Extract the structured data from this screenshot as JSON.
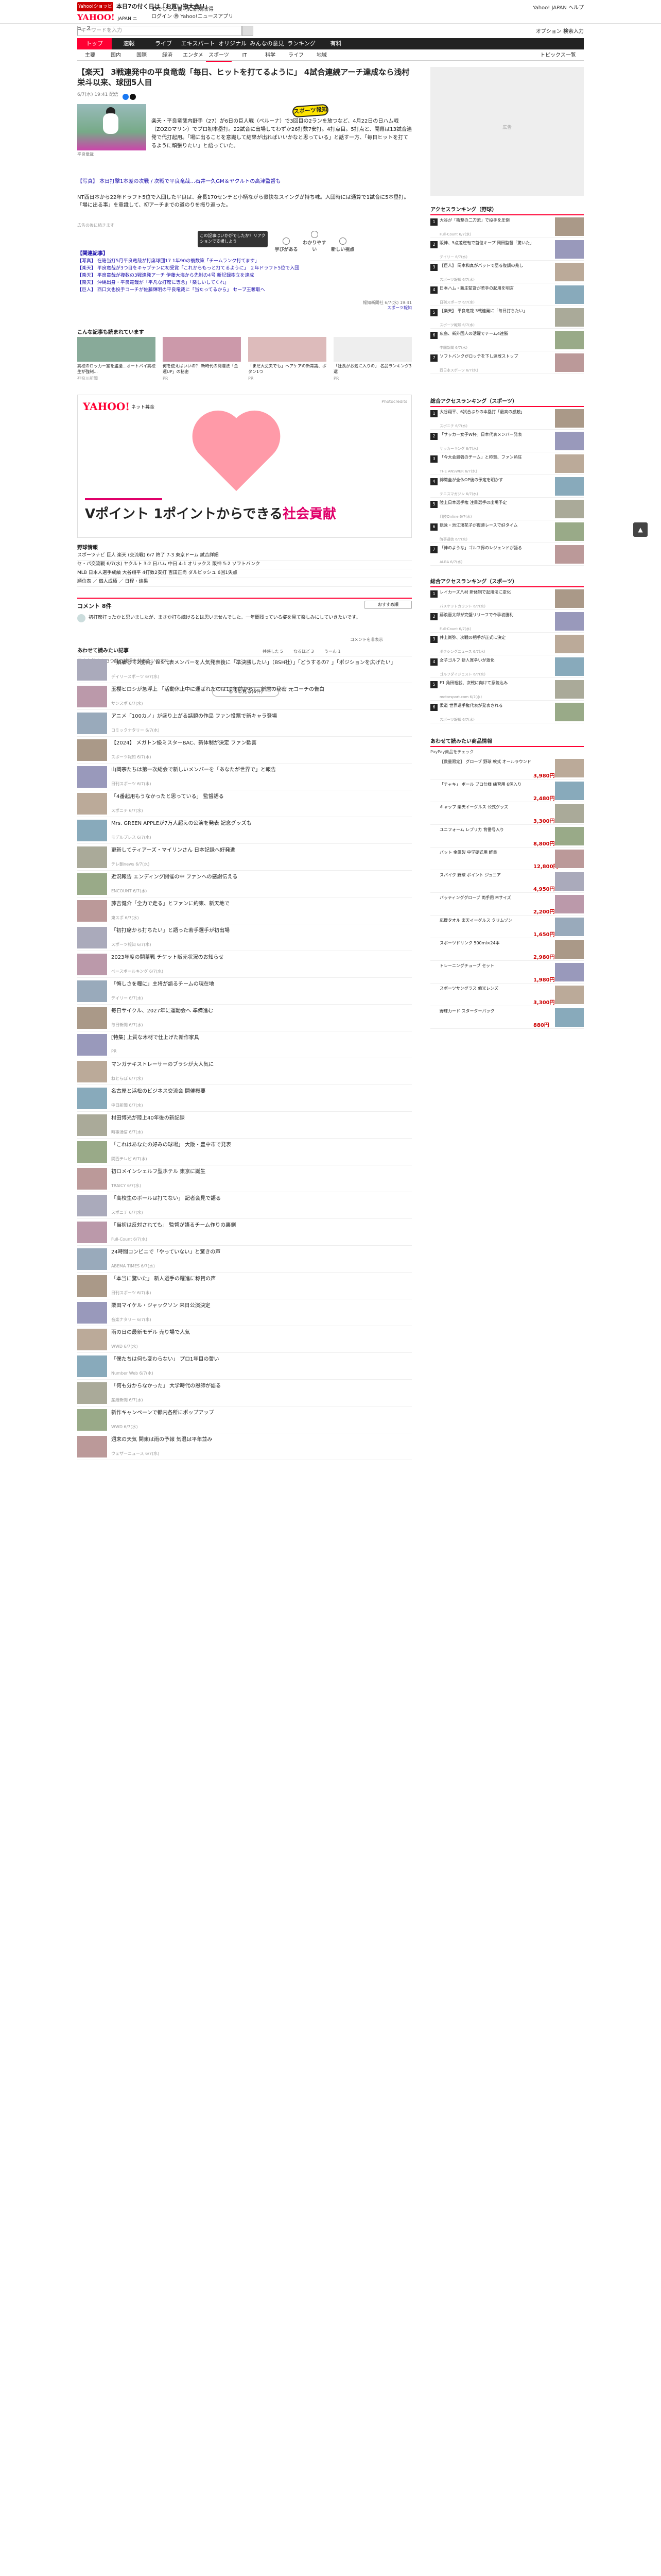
{
  "masthead": {
    "promo_badge": "Yahoo!ショッピング",
    "promo_text": "本日7の付く日は「お買い物大会!!」",
    "logo": "YAHOO!",
    "logo_sub": "JAPAN ニュース",
    "toplinks": "IDでもっと便利に新規取得\nログイン ㊚ Yahoo!ニュースアプリ",
    "topright": "Yahoo! JAPAN  ヘルプ",
    "search_placeholder": "キーワードを入力",
    "search_options": "オプション  検索入力"
  },
  "nav": {
    "items": [
      "トップ",
      "速報",
      "ライブ",
      "エキスパート",
      "オリジナル",
      "みんなの意見",
      "ランキング",
      "有料"
    ],
    "active": 0
  },
  "subnav": {
    "items": [
      "主要",
      "国内",
      "国際",
      "経済",
      "エンタメ",
      "スポーツ",
      "IT",
      "科学",
      "ライフ",
      "地域"
    ],
    "more": "トピックス一覧"
  },
  "article": {
    "title": "【楽天】 3戦連発中の平良竜哉「毎日、ヒットを打てるように」 4試合連続アーチ達成なら浅村栄斗以来、球団5人目",
    "meta": "6/7(水) 19:41 配信",
    "badge": "スポーツ報知",
    "photo_caption": "平良竜哉",
    "lead": "楽天・平良竜哉内野手（27）が6日の巨人戦（ペルーナ）で3回目の2ランを放つなど、4月22日の日ハム戦（ZOZOマリン）でプロ初本塁打。22試合に出場してわずか26打数7安打。4打点目。5打点と、開幕は13試合連発で代打起用。「場に出ることを意識して結果が出ればいいかなと思っている」と話す一方、「毎日ヒットを打てるように頑張りたい」と語っていた。",
    "related": "【写真】 本日打撃1本差の次戦 / 次戦で平良竜哉…石井一久GM＆ヤクルトの高津監督も",
    "body": "NT西日本から22年ドラフト5位で入団した平良は、身長170センチと小柄ながら豪快なスイングが持ち味。入団時には通算で1試合に5本塁打。「場に出る事」を意識して、初アーチまでの道のりを振り返った。",
    "ad_label": "広告の後に続きます",
    "tip": "この記事はいかがでしたか？リアクションで支援しよう",
    "reactions": [
      "学びがある",
      "わかりやすい",
      "新しい視点"
    ],
    "related_heading": "【関連記事】",
    "related_list": [
      "【写真】 在籍当打5月平良竜哉が打席球団17 1年90の複数策「チームランク打てます」",
      "【楽天】 平良竜哉が3つ目をキャプテンに初受賞「これからもっと打てるように」 ２年ドラフト5位で入団",
      "【楽天】 平良竜哉が複数の3戦連発アーチ 伊藤大海から先制の4号 新記録樹立を達成",
      "【楽天】 沖縄出身・平良竜哉が「平凡な打席に専念」「楽しいしてくれ」",
      "【巨人】 西口文也投手コーチが佐藤輝明の平良竜哉に「当たってるから」 セーブ王奪取へ"
    ],
    "credit": "報知新聞社 6/7(水) 19:41",
    "credit_link": "スポーツ報知"
  },
  "recommend": {
    "heading": "こんな記事も読まれています",
    "cards": [
      {
        "text": "高校のロッカー室を盗撮…オートバイ高校生が強制…",
        "src": "神奈川新聞"
      },
      {
        "text": "何を使えばいいの？ 新時代の開運法「金運UP」の秘密",
        "src": "PR"
      },
      {
        "text": "「まだ大丈夫でも」ヘアケアの新常識、ボタン1つ",
        "src": "PR"
      },
      {
        "text": "「社長がお気に入りの」 名品ランキング3選",
        "src": "PR"
      }
    ]
  },
  "bigad": {
    "logo": "YAHOO!",
    "logo_sub": "ネット募金",
    "credit": "Photocredits",
    "headline_1": "Vポイント",
    "headline_2": "1ポイントからできる",
    "headline_3": "社会貢献"
  },
  "scores": {
    "heading": "野球情報",
    "rows": [
      "スポーツナビ  巨人 楽天 (交流戦) 6/7 終了  7-3  東京ドーム  試合詳細",
      "セ・パ交流戦 6/7(水)  ヤクルト 3-2 日ハム  中日 4-1 オリックス  阪神 5-2 ソフトバンク",
      "MLB 日本人選手成績  大谷翔平 4打数2安打  吉田正尚  ダルビッシュ 6回1失点",
      "順位表 ／ 個人成績 ／ 日程・結果"
    ]
  },
  "comments": {
    "heading": "コメント 8件",
    "sort": "おすすめ順",
    "first_text": "初打席打ったかと思いましたが、まさか打ち続けるとは思いませんでした。一年間残っている姿を見て楽しみにしていきたいです。",
    "actions": [
      "共感した 5",
      "なるほど 3",
      "うーん 1"
    ],
    "second_text": "平良竜哉さん 3つ目の球場を持ちたいです",
    "more": "もっと見る(6件)",
    "hide_label": "コメントを非表示"
  },
  "list": {
    "heading": "あわせて読みたい記事",
    "items": [
      {
        "t": "「解雇して2度目」BIS代表メンバーを人気発表後に「準決勝したい」（BSH社）」「どうするの？」「ポジションを広げたい」",
        "s": "デイリースポーツ 6/7(水)"
      },
      {
        "t": "玉櫻ヒロシが急浮上 「活動休止中に運ばれたのは10年前から」、新居の秘密 元コーチの告白",
        "s": "サンスポ 6/7(水)"
      },
      {
        "t": "アニメ「100カノ」が盛り上がる話題の作品 ファン投票で新キャラ登場",
        "s": "コミックナタリー 6/7(水)"
      },
      {
        "t": "【2024】 メガトン級ミスターBAC、新体制が決定 ファン歓喜",
        "s": "スポーツ報知 6/7(水)"
      },
      {
        "t": "山岡宗たちは第一次総会で新しいメンバーを「あなたが世界で」と報告",
        "s": "日刊スポーツ 6/7(水)"
      },
      {
        "t": "「4番起用もうなかったと思っている」 監督語る",
        "s": "スポニチ 6/7(水)"
      },
      {
        "t": "Mrs. GREEN APPLEが7万人超えの公演を発表 記念グッズも",
        "s": "モデルプレス 6/7(水)"
      },
      {
        "t": "更新してティアーズ・マイリンさん 日本記録へ好発進",
        "s": "テレ朝news 6/7(水)"
      },
      {
        "t": "近況報告 エンディング開催の中 ファンへの感謝伝える",
        "s": "ENCOUNT 6/7(水)"
      },
      {
        "t": "藤吉健介「全力で走る」とファンに約束、新天地で",
        "s": "東スポ 6/7(水)"
      },
      {
        "t": "「初打席から打ちたい」と語った若手選手が初出場",
        "s": "スポーツ報知 6/7(水)"
      },
      {
        "t": "2023年度の開幕戦 チケット販売状況のお知らせ",
        "s": "ベースボールキング 6/7(水)"
      },
      {
        "t": "「悔しさを糧に」主将が語るチームの現在地",
        "s": "デイリー 6/7(水)"
      },
      {
        "t": "毎日サイクル、2027年に運動会へ 準備進む",
        "s": "毎日新聞 6/7(水)"
      },
      {
        "t": "[特集] 上質な木材で仕上げた新作家具",
        "s": "PR"
      },
      {
        "t": "マンガテキストレーサーのブラシが大人気に",
        "s": "ねとらぼ 6/7(水)"
      },
      {
        "t": "名古屋と浜松のビジネス交流会 開催概要",
        "s": "中日新聞 6/7(水)"
      },
      {
        "t": "村田博光が陸上40年後の新記録",
        "s": "時事通信 6/7(水)"
      },
      {
        "t": "「これはあなたの好みの球場」 大阪・豊中市で発表",
        "s": "関西テレビ 6/7(水)"
      },
      {
        "t": "初ロメインシェルフ型ホテル 東京に誕生",
        "s": "TRAICY 6/7(水)"
      },
      {
        "t": "「高校生のボールは打てない」 記者会見で語る",
        "s": "スポニチ 6/7(水)"
      },
      {
        "t": "「当初は反対されても」 監督が語るチーム作りの裏側",
        "s": "Full-Count 6/7(水)"
      },
      {
        "t": "24時間コンビニで「やっていない」と驚きの声",
        "s": "ABEMA TIMES 6/7(水)"
      },
      {
        "t": "「本当に驚いた」 新人選手の躍進に称賛の声",
        "s": "日刊スポーツ 6/7(水)"
      },
      {
        "t": "栗田マイケル・ジャックソン 来日公演決定",
        "s": "音楽ナタリー 6/7(水)"
      },
      {
        "t": "雨の日の最新モデル 売り場で人気",
        "s": "WWD 6/7(水)"
      },
      {
        "t": "「僕たちは何も変わらない」 プロ1年目の誓い",
        "s": "Number Web 6/7(水)"
      },
      {
        "t": "「何も分からなかった」 大学時代の恩師が語る",
        "s": "産経新聞 6/7(水)"
      },
      {
        "t": "新作キャンペーンで都内各所にポップアップ",
        "s": "WWD 6/7(水)"
      },
      {
        "t": "週末の天気 関東は雨の予報 気温は平年並み",
        "s": "ウェザーニュース 6/7(水)"
      }
    ]
  },
  "side": {
    "ad_label": "広告",
    "rank1": {
      "heading": "アクセスランキング（野球）",
      "items": [
        {
          "t": "大谷が「衝撃の二刀流」で投手を圧倒",
          "s": "Full-Count 6/7(水)"
        },
        {
          "t": "阪神、5点差逆転で首位キープ 岡田監督「驚いた」",
          "s": "デイリー 6/7(水)"
        },
        {
          "t": "【巨人】 岡本和真がバットで語る復調の兆し",
          "s": "スポーツ報知 6/7(水)"
        },
        {
          "t": "日本ハム・新庄監督が若手の起用を明言",
          "s": "日刊スポーツ 6/7(水)"
        },
        {
          "t": "【楽天】 平良竜哉 3戦連発に「毎日打ちたい」",
          "s": "スポーツ報知 6/7(水)"
        },
        {
          "t": "広島、新外国人の活躍でチーム4連勝",
          "s": "中国新聞 6/7(水)"
        },
        {
          "t": "ソフトバンクがロッテを下し連敗ストップ",
          "s": "西日本スポーツ 6/7(水)"
        }
      ]
    },
    "rank2": {
      "heading": "総合アクセスランキング（スポーツ）",
      "items": [
        {
          "t": "大谷翔平、6試合ぶりの本塁打「最高の感触」",
          "s": "スポニチ 6/7(水)"
        },
        {
          "t": "「サッカー女子W杯」日本代表メンバー発表",
          "s": "サッカーキング 6/7(水)"
        },
        {
          "t": "「今大会最強のチーム」と称賛、ファン熱狂",
          "s": "THE ANSWER 6/7(水)"
        },
        {
          "t": "錦織圭が全仏OP後の予定を明かす",
          "s": "テニスマガジン 6/7(水)"
        },
        {
          "t": "陸上日本選手権 注目選手の出場予定",
          "s": "月陸Online 6/7(水)"
        },
        {
          "t": "競泳・池江璃花子が復帰レースで好タイム",
          "s": "時事通信 6/7(水)"
        },
        {
          "t": "「神のような」ゴルフ界のレジェンドが語る",
          "s": "ALBA 6/7(水)"
        }
      ]
    },
    "rank3": {
      "heading": "総合アクセスランキング（スポーツ）",
      "items": [
        {
          "t": "レイカーズ八村 新体制で起用法に変化",
          "s": "バスケットカウント 6/7(水)"
        },
        {
          "t": "藤浪晋太郎が完璧リリーフで今季初勝利",
          "s": "Full-Count 6/7(水)"
        },
        {
          "t": "井上尚弥、次戦の相手が正式に決定",
          "s": "ボクシングニュース 6/7(水)"
        },
        {
          "t": "女子ゴルフ 新人賞争いが激化",
          "s": "ゴルフダイジェスト 6/7(水)"
        },
        {
          "t": "F1 角田裕毅、次戦に向けて意気込み",
          "s": "motorsport.com 6/7(水)"
        },
        {
          "t": "柔道 世界選手権代表が発表される",
          "s": "スポーツ報知 6/7(水)"
        }
      ]
    },
    "shop": {
      "heading": "あわせて読みたい商品情報",
      "sub": "PayPay商品をチェック",
      "items": [
        {
          "t": "【数量限定】 グローブ 野球 軟式 オールラウンド",
          "p": "3,980円"
        },
        {
          "t": "「チャキ」 ボール プロ仕様 練習用 6個入り",
          "p": "2,480円"
        },
        {
          "t": "キャップ 楽天イーグルス 公式グッズ",
          "p": "3,300円"
        },
        {
          "t": "ユニフォーム レプリカ 背番号入り",
          "p": "8,800円"
        },
        {
          "t": "バット 金属製 中学硬式用 軽量",
          "p": "12,800円"
        },
        {
          "t": "スパイク 野球 ポイント ジュニア",
          "p": "4,950円"
        },
        {
          "t": "バッティンググローブ 両手用 Mサイズ",
          "p": "2,200円"
        },
        {
          "t": "応援タオル 楽天イーグルス クリムゾン",
          "p": "1,650円"
        },
        {
          "t": "スポーツドリンク 500ml×24本",
          "p": "2,980円"
        },
        {
          "t": "トレーニングチューブ セット",
          "p": "1,980円"
        },
        {
          "t": "スポーツサングラス 偏光レンズ",
          "p": "3,300円"
        },
        {
          "t": "野球カード スターターパック",
          "p": "880円"
        }
      ]
    }
  },
  "scrolltop_label": "▲"
}
